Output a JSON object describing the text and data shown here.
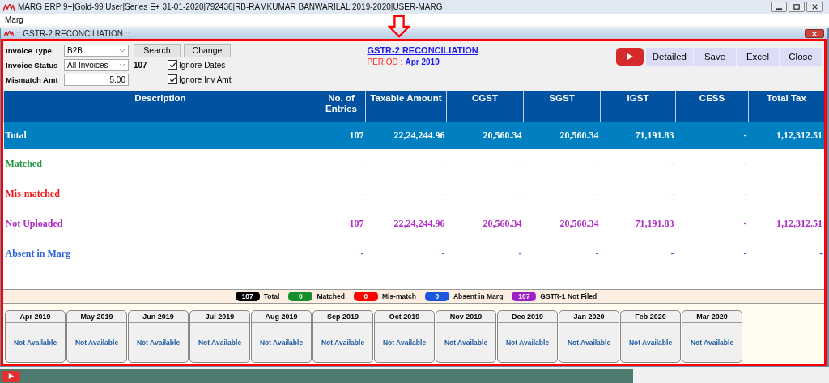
{
  "window": {
    "title": "MARG ERP 9+|Gold-99 User|Series E+ 31-01-2020|792436|RB-RAMKUMAR BANWARILAL 2019-2020|USER-MARG"
  },
  "menu": [
    "Marg"
  ],
  "child_window": {
    "title": ":: GSTR-2 RECONCILIATION ::"
  },
  "filters": {
    "invoice_type_label": "Invoice Type",
    "invoice_type": "B2B",
    "invoice_status_label": "Invoice Status",
    "invoice_status": "All Invoices",
    "count": "107",
    "mismatch_label": "Mismatch Amt",
    "mismatch_amt": "5.00",
    "search_button": "Search",
    "change_button": "Change"
  },
  "options": [
    {
      "label": "Ignore Dates",
      "checked": true
    },
    {
      "label": "Ignore Inv Amt",
      "checked": true
    }
  ],
  "heading": {
    "title": "GSTR-2 RECONCILIATION",
    "period_label": "PERIOD :",
    "period": "Apr 2019"
  },
  "actions": [
    "Detailed",
    "Save",
    "Excel",
    "Close"
  ],
  "table": {
    "columns": [
      "Description",
      "No. of Entries",
      "Taxable Amount",
      "CGST",
      "SGST",
      "IGST",
      "CESS",
      "Total Tax"
    ],
    "rows": [
      {
        "selected": true,
        "color": "#ffffff",
        "cells": [
          "Total",
          "107",
          "22,24,244.96",
          "20,560.34",
          "20,560.34",
          "71,191.83",
          "-",
          "1,12,312.51"
        ]
      },
      {
        "selected": false,
        "color": "#1e9640",
        "cells": [
          "Matched",
          "-",
          "-",
          "-",
          "-",
          "-",
          "-",
          "-"
        ]
      },
      {
        "selected": false,
        "color": "#f01818",
        "cells": [
          "Mis-matched",
          "-",
          "-",
          "-",
          "-",
          "-",
          "-",
          "-"
        ]
      },
      {
        "selected": false,
        "color": "#b02cc8",
        "cells": [
          "Not Uploaded",
          "107",
          "22,24,244.96",
          "20,560.34",
          "20,560.34",
          "71,191.83",
          "-",
          "1,12,312.51"
        ]
      },
      {
        "selected": false,
        "color": "#2c62e0",
        "cells": [
          "Absent in Marg",
          "-",
          "-",
          "-",
          "-",
          "-",
          "-",
          "-"
        ]
      }
    ]
  },
  "legend": [
    {
      "count": "107",
      "label": "Total",
      "color": "#000000"
    },
    {
      "count": "0",
      "label": "Matched",
      "color": "#16902e"
    },
    {
      "count": "0",
      "label": "Mis-match",
      "color": "#ff0000"
    },
    {
      "count": "0",
      "label": "Absent in Marg",
      "color": "#1a56e0"
    },
    {
      "count": "107",
      "label": "GSTR-1 Not Filed",
      "color": "#a020c8"
    }
  ],
  "months": [
    {
      "month": "Apr 2019",
      "status": "Not Available"
    },
    {
      "month": "May 2019",
      "status": "Not Available"
    },
    {
      "month": "Jun 2019",
      "status": "Not Available"
    },
    {
      "month": "Jul 2019",
      "status": "Not Available"
    },
    {
      "month": "Aug 2019",
      "status": "Not Available"
    },
    {
      "month": "Sep 2019",
      "status": "Not Available"
    },
    {
      "month": "Oct 2019",
      "status": "Not Available"
    },
    {
      "month": "Nov 2019",
      "status": "Not Available"
    },
    {
      "month": "Dec 2019",
      "status": "Not Available"
    },
    {
      "month": "Jan 2020",
      "status": "Not Available"
    },
    {
      "month": "Feb 2020",
      "status": "Not Available"
    },
    {
      "month": "Mar 2020",
      "status": "Not Available"
    }
  ]
}
